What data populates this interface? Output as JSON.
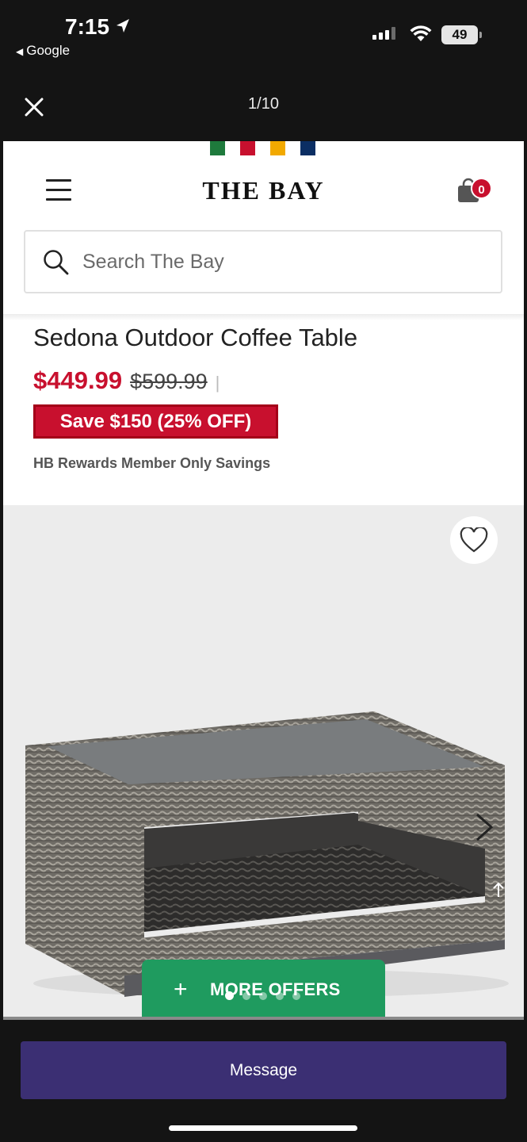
{
  "status_bar": {
    "time": "7:15",
    "back_app": "Google",
    "battery": "49"
  },
  "viewer": {
    "counter": "1/10"
  },
  "site": {
    "logo": "THE BAY",
    "cart_count": "0",
    "stripe_colors": [
      "#1e7a3c",
      "#c8102e",
      "#f2a900",
      "#0b2e63"
    ],
    "search_placeholder": "Search The Bay"
  },
  "product": {
    "title": "Sedona Outdoor Coffee Table",
    "sale_price": "$449.99",
    "original_price": "$599.99",
    "separator": "|",
    "savings": "Save $150 (25% OFF)",
    "rewards_note": "HB Rewards Member Only Savings"
  },
  "gallery": {
    "more_offers": "MORE OFFERS",
    "slide_count": 5,
    "active_slide": 1
  },
  "message_button": "Message",
  "colors": {
    "accent_red": "#c8102e",
    "offers_green": "#1f9b5f",
    "message_purple": "#3b2f73"
  }
}
